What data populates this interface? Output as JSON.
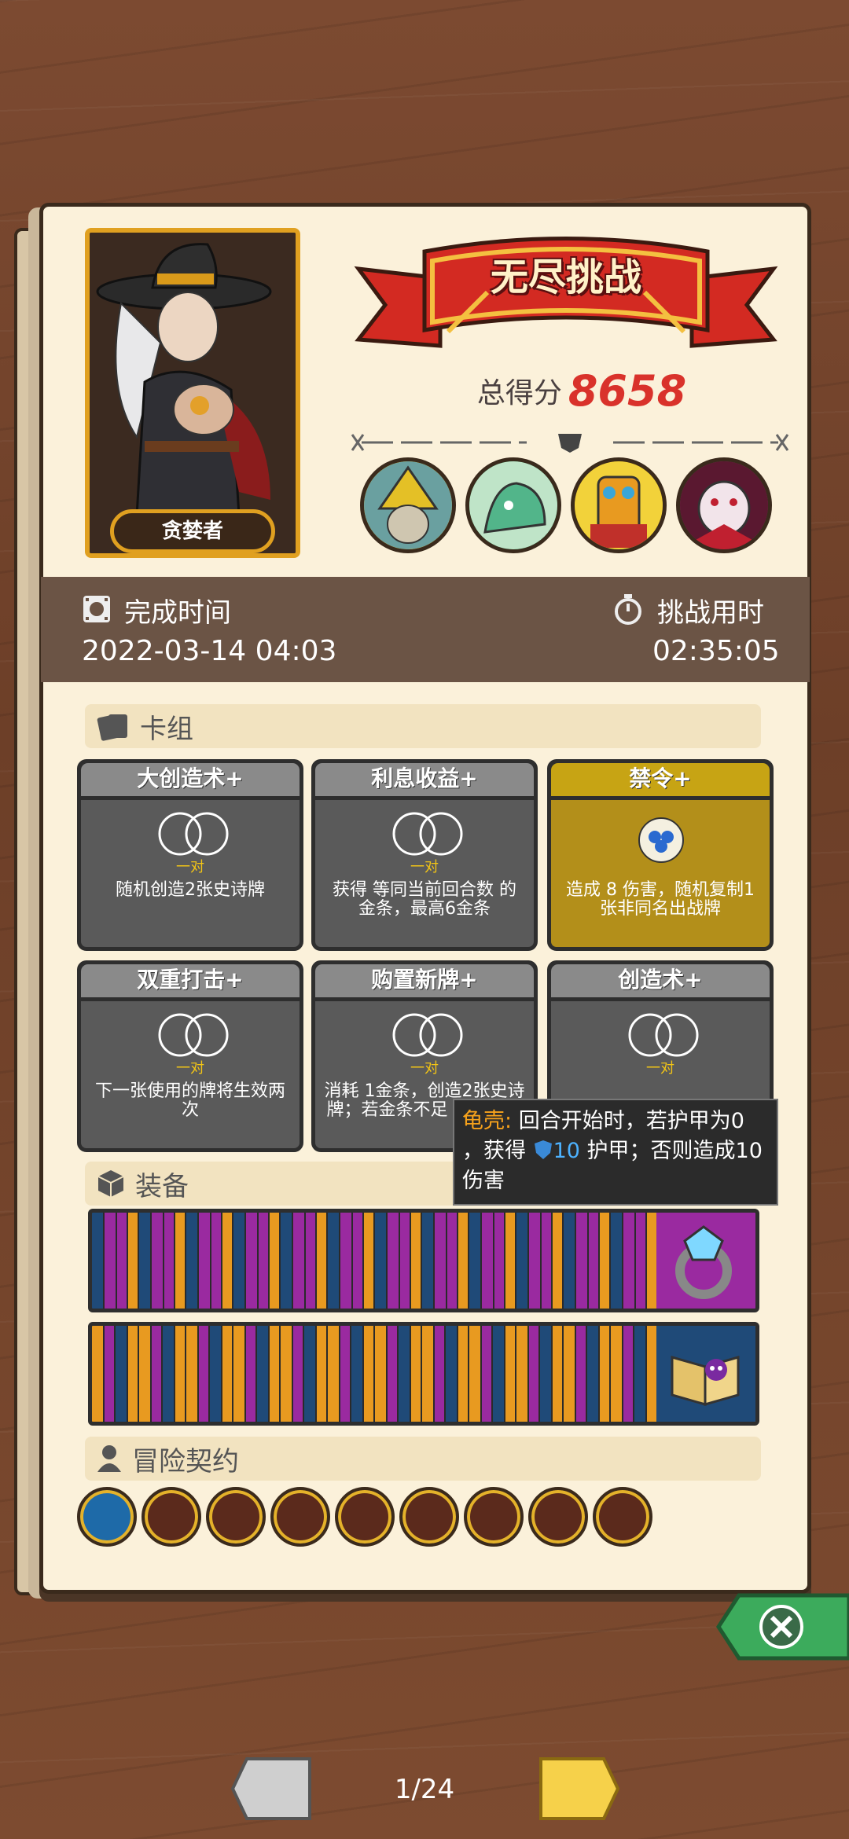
{
  "banner": {
    "title": "无尽挑战"
  },
  "score": {
    "label": "总得分",
    "value": "8658"
  },
  "character": {
    "name": "贪婪者"
  },
  "stats": {
    "finish_time_label": "完成时间",
    "finish_time_value": "2022-03-14 04:03",
    "duration_label": "挑战用时",
    "duration_value": "02:35:05"
  },
  "sections": {
    "deck": "卡组",
    "equipment": "装备",
    "contracts": "冒险契约"
  },
  "cards": [
    {
      "title": "大创造术+",
      "tag": "一对",
      "desc": "随机创造2张史诗牌"
    },
    {
      "title": "利息收益+",
      "tag": "一对",
      "desc": "获得 等同当前回合数 的 金条，最高6金条"
    },
    {
      "title": "禁令+",
      "tag": "",
      "desc": "造成 8 伤害，随机复制1张非同名出战牌"
    },
    {
      "title": "双重打击+",
      "tag": "一对",
      "desc": "下一张使用的牌将生效两次"
    },
    {
      "title": "购置新牌+",
      "tag": "一对",
      "desc": "消耗 1金条，创造2张史诗牌；若金条不足 张普通牌"
    },
    {
      "title": "创造术+",
      "tag": "一对",
      "desc": ""
    }
  ],
  "tooltip": {
    "keyword": "龟壳:",
    "line1": "回合开始时，若护甲为0",
    "line2_pre": "，获得",
    "armor_value": "10",
    "line2_post": "护甲；否则造成10",
    "line3": "伤害"
  },
  "pager": {
    "text": "1/24"
  },
  "icons": {
    "finish_time": "film-clock-icon",
    "duration": "stopwatch-icon",
    "deck": "cards-icon",
    "equipment": "cube-icon",
    "contracts": "person-icon",
    "close": "close-icon"
  },
  "colors": {
    "score": "#d9322b",
    "tag": "#f3c515",
    "keyword": "#f6a21c",
    "armor": "#4db2ff"
  }
}
